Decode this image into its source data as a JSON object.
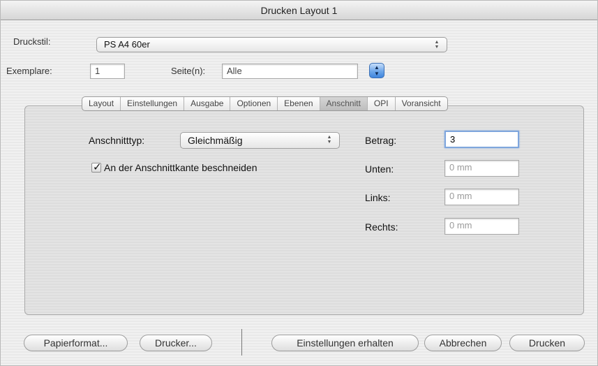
{
  "window": {
    "title": "Drucken Layout 1"
  },
  "druckstil": {
    "label": "Druckstil:",
    "value": "PS A4 60er"
  },
  "exemplare": {
    "label": "Exemplare:",
    "value": "1"
  },
  "seiten": {
    "label": "Seite(n):",
    "value": "Alle"
  },
  "tabs": [
    {
      "label": "Layout"
    },
    {
      "label": "Einstellungen"
    },
    {
      "label": "Ausgabe"
    },
    {
      "label": "Optionen"
    },
    {
      "label": "Ebenen"
    },
    {
      "label": "Anschnitt",
      "active": true
    },
    {
      "label": "OPI"
    },
    {
      "label": "Voransicht"
    }
  ],
  "anschnitt": {
    "type_label": "Anschnitttyp:",
    "type_value": "Gleichmäßig",
    "clip_label": "An der Anschnittkante beschneiden",
    "clip_checked": true,
    "betrag_label": "Betrag:",
    "betrag_value": "3",
    "unten_label": "Unten:",
    "unten_value": "0 mm",
    "links_label": "Links:",
    "links_value": "0 mm",
    "rechts_label": "Rechts:",
    "rechts_value": "0 mm"
  },
  "buttons": {
    "papierformat": "Papierformat...",
    "drucker": "Drucker...",
    "einstellungen": "Einstellungen erhalten",
    "abbrechen": "Abbrechen",
    "drucken": "Drucken"
  },
  "colors": {
    "focus_ring": "#7fa6dd",
    "blue_button": "#3f85dd"
  }
}
